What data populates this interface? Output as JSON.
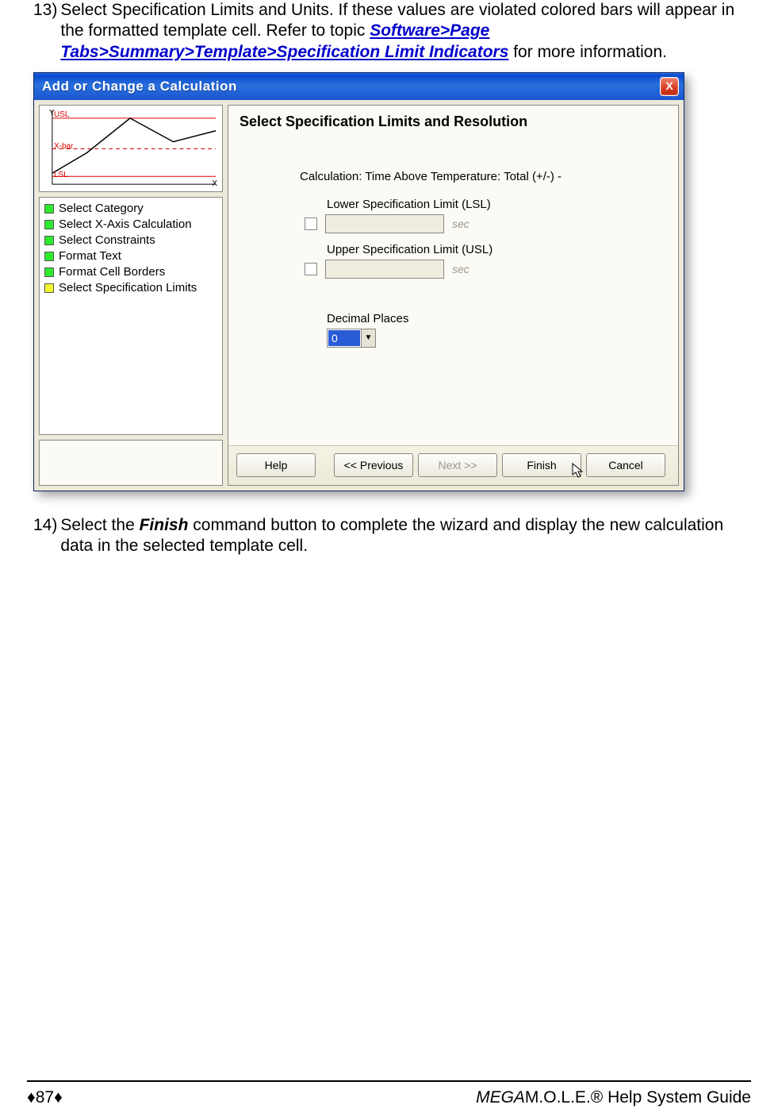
{
  "step13": {
    "num": "13)",
    "t1": "Select Specification Limits and Units. If these values are violated colored bars will appear in the formatted template cell. Refer to  topic ",
    "link": "Software>Page Tabs>Summary>Template>Specification Limit Indicators",
    "t2": " for more information."
  },
  "dialog": {
    "title": "Add or Change a Calculation",
    "close": "X",
    "preview": {
      "y": "Y",
      "usl": "USL",
      "xbar": "X-bar",
      "lsl": "LSL",
      "x": "X"
    },
    "steps": [
      {
        "label": "Select Category",
        "color": "green"
      },
      {
        "label": "Select X-Axis Calculation",
        "color": "green"
      },
      {
        "label": "Select Constraints",
        "color": "green"
      },
      {
        "label": "Format Text",
        "color": "green"
      },
      {
        "label": "Format Cell Borders",
        "color": "green"
      },
      {
        "label": "Select Specification Limits",
        "color": "yellow"
      }
    ],
    "heading": "Select Specification Limits and Resolution",
    "calc": "Calculation: Time Above Temperature: Total (+/-) -",
    "lsl_label": "Lower Specification Limit (LSL)",
    "usl_label": "Upper Specification Limit (USL)",
    "unit": "sec",
    "dec_label": "Decimal Places",
    "dec_value": "0",
    "buttons": {
      "help": "Help",
      "prev": "<< Previous",
      "next": "Next >>",
      "finish": "Finish",
      "cancel": "Cancel"
    }
  },
  "step14": {
    "num": "14)",
    "t1": "Select the ",
    "finish": "Finish",
    "t2": " command button to complete the wizard and display the new calculation data in the selected template cell."
  },
  "footer": {
    "dia": "♦",
    "page": "87",
    "brand1": "MEGA",
    "brand2": "M.O.L.E.® Help System Guide"
  }
}
